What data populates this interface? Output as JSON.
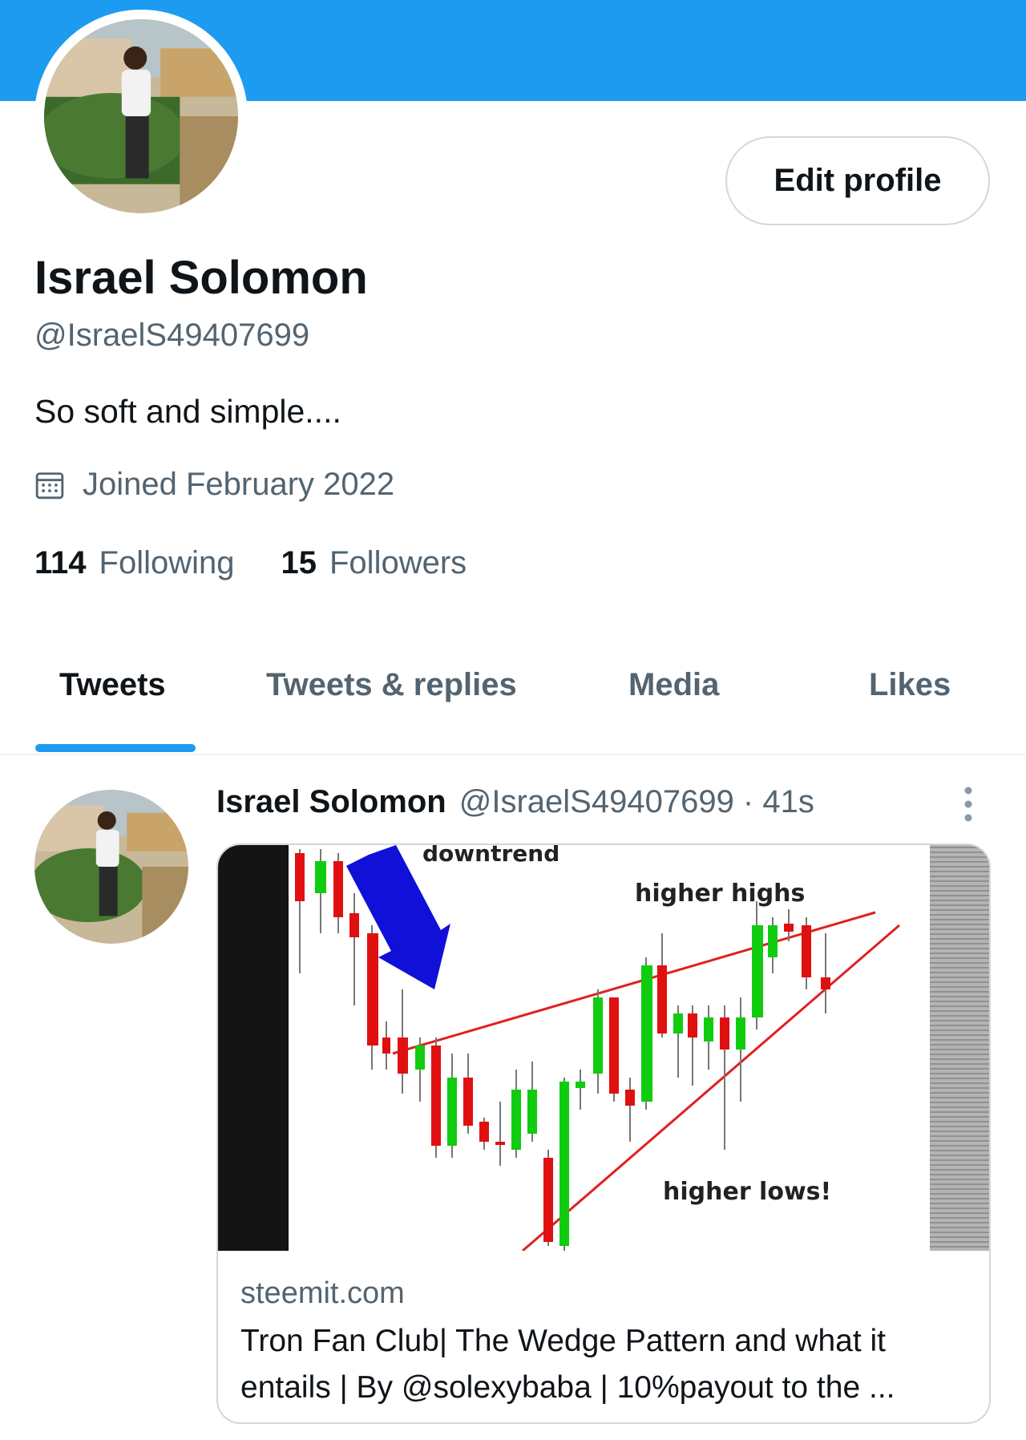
{
  "profile": {
    "name": "Israel Solomon",
    "handle": "@IsraelS49407699",
    "bio": "So soft and simple....",
    "joined": "Joined February 2022",
    "following_count": "114",
    "following_label": "Following",
    "followers_count": "15",
    "followers_label": "Followers",
    "edit_label": "Edit profile"
  },
  "tabs": [
    {
      "label": "Tweets"
    },
    {
      "label": "Tweets & replies"
    },
    {
      "label": "Media"
    },
    {
      "label": "Likes"
    }
  ],
  "tweet": {
    "name": "Israel Solomon",
    "meta": "@IsraelS49407699 · 41s",
    "card": {
      "domain": "steemit.com",
      "title": "Tron Fan Club| The Wedge Pattern and what it entails | By @solexybaba | 10%payout to the ...",
      "image_labels": {
        "downtrend": "downtrend",
        "higher_highs": "higher highs",
        "higher_lows": "higher lows!"
      }
    }
  },
  "colors": {
    "accent": "#1d9bf0",
    "text": "#0f1419",
    "muted": "#536471",
    "border": "#cfd9de"
  }
}
